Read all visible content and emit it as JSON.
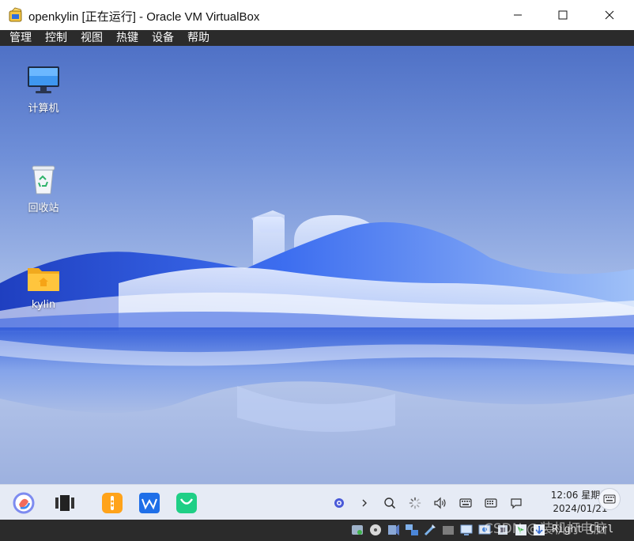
{
  "window": {
    "title": "openkylin [正在运行] - Oracle VM VirtualBox",
    "icon": "virtualbox-icon",
    "controls": [
      "minimize-icon",
      "maximize-icon",
      "close-icon"
    ]
  },
  "menubar": {
    "items": [
      "管理",
      "控制",
      "视图",
      "热键",
      "设备",
      "帮助"
    ]
  },
  "desktop": {
    "wallpaper_colors": [
      "#4f71c6",
      "#2f5be0",
      "#b9c9ec"
    ],
    "icons": [
      {
        "label": "计算机",
        "icon": "monitor-icon"
      },
      {
        "label": "回收站",
        "icon": "trash-icon"
      },
      {
        "label": "kylin",
        "icon": "home-folder-icon"
      }
    ]
  },
  "taskbar": {
    "apps": [
      "start-menu-icon",
      "multitask-view-icon",
      "file-manager-icon",
      "wps-office-icon",
      "software-store-icon"
    ],
    "tray": [
      "network-indicator-icon",
      "chevron-right-icon",
      "search-icon",
      "loading-icon",
      "volume-icon",
      "keyboard-icon",
      "input-method-icon",
      "notification-icon"
    ],
    "clock_time": "12:06 星期日",
    "clock_date": "2024/01/21",
    "virtual_keyboard_icon": "virtual-keyboard-icon"
  },
  "statusbar": {
    "icons": [
      "hard-disk-icon",
      "optical-drive-icon",
      "audio-icon",
      "network-icon",
      "usb-icon",
      "shared-folder-icon",
      "display-icon",
      "video-capture-icon",
      "cpu-activity-icon",
      "mouse-integration-icon"
    ],
    "host_key": "Right Ctrl",
    "watermark": "CSDN @装机打电脑"
  },
  "colors": {
    "menubar_bg": "#2b2b2b",
    "taskbar_bg": "#e6ebf5",
    "accent_blue": "#2f6fe0"
  }
}
